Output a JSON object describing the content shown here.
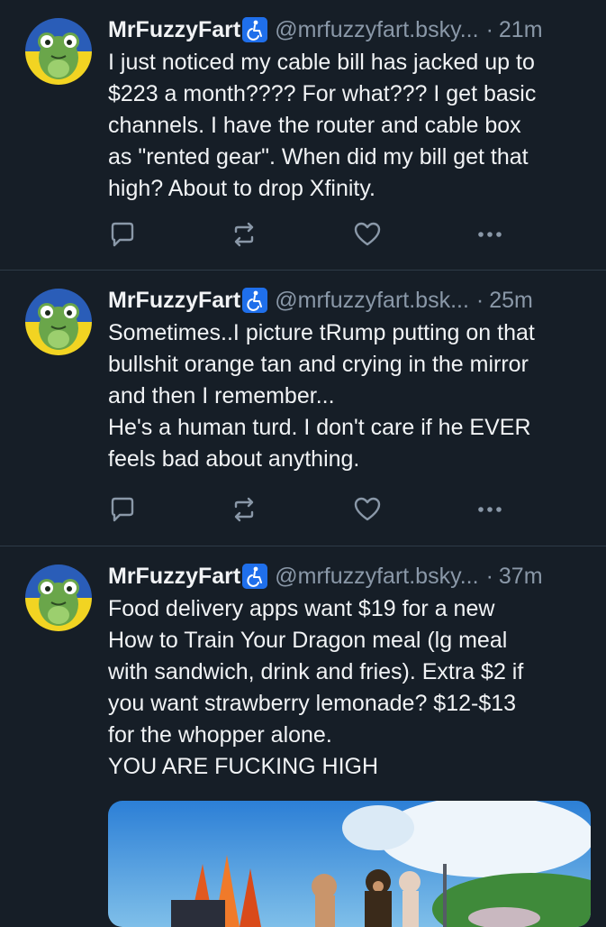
{
  "colors": {
    "background": "#161e27",
    "text": "#f1f3f5",
    "muted": "#8a98a8",
    "divider": "#2e3a47",
    "badge": "#1f6feb"
  },
  "posts": [
    {
      "display_name": "MrFuzzyFart",
      "handle": "@mrfuzzyfart.bsky...",
      "separator": "·",
      "time": "21m",
      "text": "I just noticed my cable bill has jacked up to\n$223 a month???? For what??? I get basic\nchannels. I have the router and cable box\nas \"rented gear\". When did my bill get that\nhigh? About to drop Xfinity."
    },
    {
      "display_name": "MrFuzzyFart",
      "handle": "@mrfuzzyfart.bsk...",
      "separator": "·",
      "time": "25m",
      "text": "Sometimes..I picture tRump putting on that\nbullshit orange tan and crying in the mirror\nand then I remember...\nHe's a human turd. I don't care if he EVER\nfeels bad about anything."
    },
    {
      "display_name": "MrFuzzyFart",
      "handle": "@mrfuzzyfart.bsky...",
      "separator": "·",
      "time": "37m",
      "text": "Food delivery apps want $19 for a new\nHow to Train Your Dragon meal (lg meal\nwith sandwich, drink and fries). Extra $2 if\nyou want strawberry lemonade? $12-$13\nfor the whopper alone.\nYOU ARE FUCKING HIGH"
    }
  ],
  "icons": {
    "reply": "reply-icon",
    "repost": "repost-icon",
    "like": "heart-icon",
    "more": "more-options-icon",
    "badge": "accessibility-icon"
  }
}
